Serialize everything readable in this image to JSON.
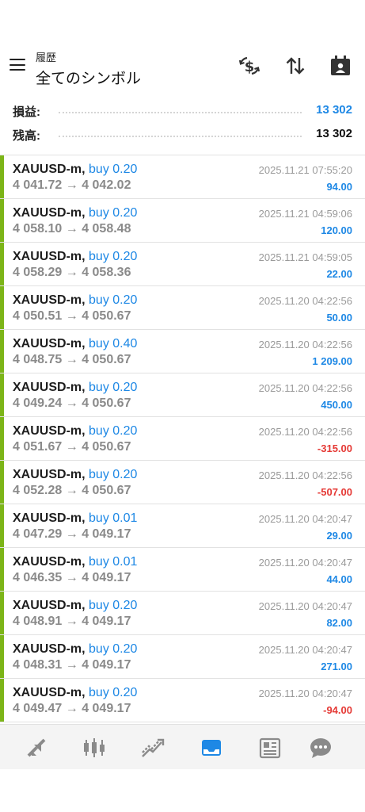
{
  "header": {
    "subtitle": "履歴",
    "title": "全てのシンボル",
    "icons": [
      "menu-icon",
      "currency-exchange-icon",
      "sort-icon",
      "calendar-icon"
    ]
  },
  "summary": {
    "profit_label": "損益:",
    "profit_value": "13 302",
    "balance_label": "残高:",
    "balance_value": "13 302"
  },
  "colors": {
    "accent": "#1e88e5",
    "negative": "#e53935",
    "buy_bar": "#7cb518",
    "muted": "#8a8a8a"
  },
  "trades": [
    {
      "symbol": "XAUUSD-m,",
      "side": "buy 0.20",
      "open": "4 041.72",
      "close": "4 042.02",
      "time": "2025.11.21 07:55:20",
      "profit": "94.00",
      "sign": "pos"
    },
    {
      "symbol": "XAUUSD-m,",
      "side": "buy 0.20",
      "open": "4 058.10",
      "close": "4 058.48",
      "time": "2025.11.21 04:59:06",
      "profit": "120.00",
      "sign": "pos"
    },
    {
      "symbol": "XAUUSD-m,",
      "side": "buy 0.20",
      "open": "4 058.29",
      "close": "4 058.36",
      "time": "2025.11.21 04:59:05",
      "profit": "22.00",
      "sign": "pos"
    },
    {
      "symbol": "XAUUSD-m,",
      "side": "buy 0.20",
      "open": "4 050.51",
      "close": "4 050.67",
      "time": "2025.11.20 04:22:56",
      "profit": "50.00",
      "sign": "pos"
    },
    {
      "symbol": "XAUUSD-m,",
      "side": "buy 0.40",
      "open": "4 048.75",
      "close": "4 050.67",
      "time": "2025.11.20 04:22:56",
      "profit": "1 209.00",
      "sign": "pos"
    },
    {
      "symbol": "XAUUSD-m,",
      "side": "buy 0.20",
      "open": "4 049.24",
      "close": "4 050.67",
      "time": "2025.11.20 04:22:56",
      "profit": "450.00",
      "sign": "pos"
    },
    {
      "symbol": "XAUUSD-m,",
      "side": "buy 0.20",
      "open": "4 051.67",
      "close": "4 050.67",
      "time": "2025.11.20 04:22:56",
      "profit": "-315.00",
      "sign": "neg"
    },
    {
      "symbol": "XAUUSD-m,",
      "side": "buy 0.20",
      "open": "4 052.28",
      "close": "4 050.67",
      "time": "2025.11.20 04:22:56",
      "profit": "-507.00",
      "sign": "neg"
    },
    {
      "symbol": "XAUUSD-m,",
      "side": "buy 0.01",
      "open": "4 047.29",
      "close": "4 049.17",
      "time": "2025.11.20 04:20:47",
      "profit": "29.00",
      "sign": "pos"
    },
    {
      "symbol": "XAUUSD-m,",
      "side": "buy 0.01",
      "open": "4 046.35",
      "close": "4 049.17",
      "time": "2025.11.20 04:20:47",
      "profit": "44.00",
      "sign": "pos"
    },
    {
      "symbol": "XAUUSD-m,",
      "side": "buy 0.20",
      "open": "4 048.91",
      "close": "4 049.17",
      "time": "2025.11.20 04:20:47",
      "profit": "82.00",
      "sign": "pos"
    },
    {
      "symbol": "XAUUSD-m,",
      "side": "buy 0.20",
      "open": "4 048.31",
      "close": "4 049.17",
      "time": "2025.11.20 04:20:47",
      "profit": "271.00",
      "sign": "pos"
    },
    {
      "symbol": "XAUUSD-m,",
      "side": "buy 0.20",
      "open": "4 049.47",
      "close": "4 049.17",
      "time": "2025.11.20 04:20:47",
      "profit": "-94.00",
      "sign": "neg"
    }
  ],
  "price_arrow": "→",
  "tabs": [
    {
      "icon": "quotes-icon",
      "active": false
    },
    {
      "icon": "chart-icon",
      "active": false
    },
    {
      "icon": "trade-icon",
      "active": false
    },
    {
      "icon": "history-icon",
      "active": true
    },
    {
      "icon": "news-icon",
      "active": false
    },
    {
      "icon": "chat-icon",
      "active": false
    }
  ]
}
